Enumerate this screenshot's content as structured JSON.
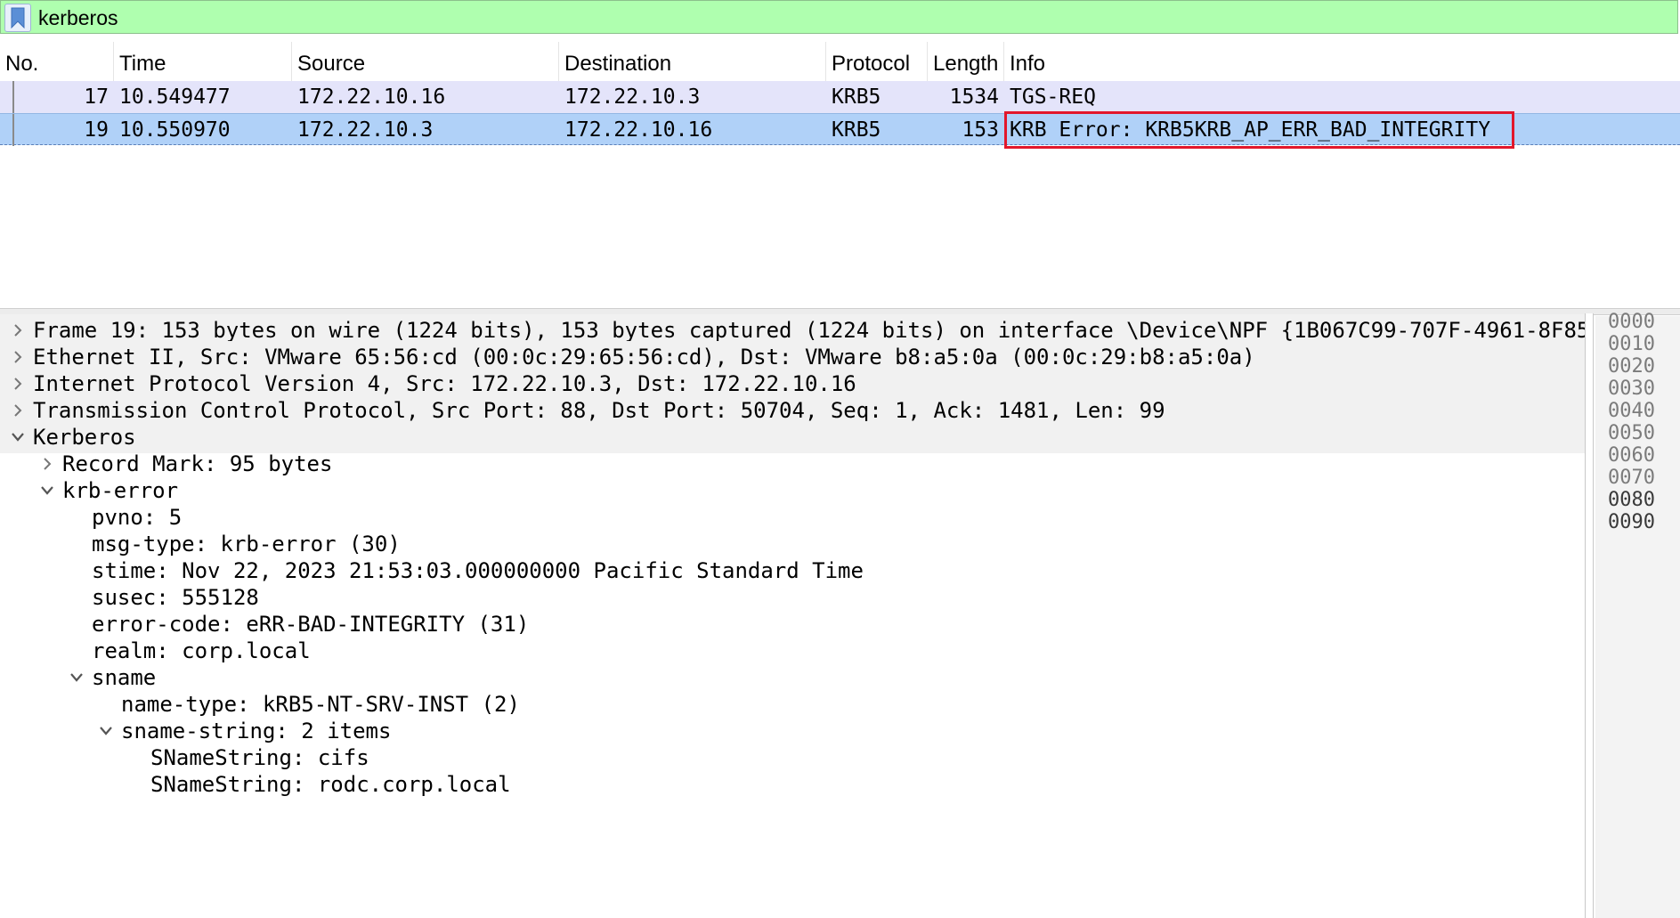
{
  "filter": {
    "value": "kerberos",
    "bookmark_icon": "bookmark-icon"
  },
  "packet_list": {
    "columns": [
      "No.",
      "Time",
      "Source",
      "Destination",
      "Protocol",
      "Length",
      "Info"
    ],
    "rows": [
      {
        "no": "17",
        "time": "10.549477",
        "source": "172.22.10.16",
        "destination": "172.22.10.3",
        "protocol": "KRB5",
        "length": "1534",
        "info": "TGS-REQ"
      },
      {
        "no": "19",
        "time": "10.550970",
        "source": "172.22.10.3",
        "destination": "172.22.10.16",
        "protocol": "KRB5",
        "length": "153",
        "info": "KRB Error: KRB5KRB_AP_ERR_BAD_INTEGRITY"
      }
    ],
    "highlight_color": "#e2172b"
  },
  "details": [
    {
      "text": "Frame 19: 153 bytes on wire (1224 bits), 153 bytes captured (1224 bits) on interface \\Device\\NPF_{1B067C99-707F-4961-8F85-",
      "arrow": "right"
    },
    {
      "text": "Ethernet II, Src: VMware_65:56:cd (00:0c:29:65:56:cd), Dst: VMware_b8:a5:0a (00:0c:29:b8:a5:0a)",
      "arrow": "right"
    },
    {
      "text": "Internet Protocol Version 4, Src: 172.22.10.3, Dst: 172.22.10.16",
      "arrow": "right"
    },
    {
      "text": "Transmission Control Protocol, Src Port: 88, Dst Port: 50704, Seq: 1, Ack: 1481, Len: 99",
      "arrow": "right"
    },
    {
      "text": "Kerberos",
      "arrow": "down"
    },
    {
      "text": "Record Mark: 95 bytes",
      "arrow": "right"
    },
    {
      "text": "krb-error",
      "arrow": "down"
    },
    {
      "text": "pvno: 5",
      "arrow": "none"
    },
    {
      "text": "msg-type: krb-error (30)",
      "arrow": "none"
    },
    {
      "text": "stime: Nov 22, 2023 21:53:03.000000000 Pacific Standard Time",
      "arrow": "none"
    },
    {
      "text": "susec: 555128",
      "arrow": "none"
    },
    {
      "text": "error-code: eRR-BAD-INTEGRITY (31)",
      "arrow": "none"
    },
    {
      "text": "realm: corp.local",
      "arrow": "none"
    },
    {
      "text": "sname",
      "arrow": "down"
    },
    {
      "text": "name-type: kRB5-NT-SRV-INST (2)",
      "arrow": "none"
    },
    {
      "text": "sname-string: 2 items",
      "arrow": "down"
    },
    {
      "text": "SNameString: cifs",
      "arrow": "none"
    },
    {
      "text": "SNameString: rodc.corp.local",
      "arrow": "none"
    }
  ],
  "bytes_offsets": [
    "0000",
    "0010",
    "0020",
    "0030",
    "0040",
    "0050",
    "0060",
    "0070",
    "0080",
    "0090"
  ]
}
